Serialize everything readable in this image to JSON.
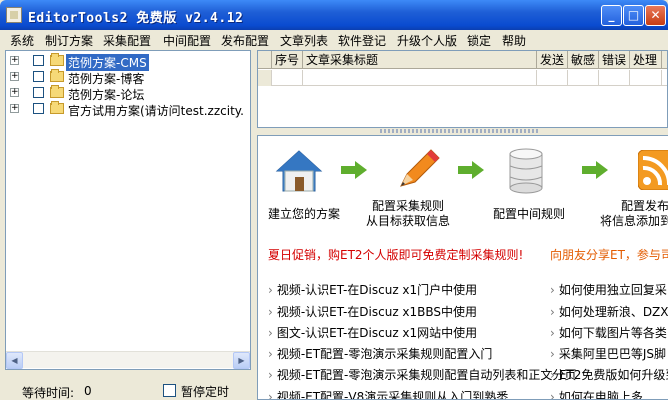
{
  "window": {
    "title": "EditorTools2 免费版 v2.4.12",
    "buttons": {
      "minimize": "_",
      "maximize": "□",
      "close": "✕"
    }
  },
  "menu": [
    "系统",
    "制订方案",
    "采集配置",
    "中间配置",
    "发布配置",
    "文章列表",
    "软件登记",
    "升级个人版",
    "锁定",
    "帮助"
  ],
  "tree": [
    {
      "label": "范例方案-CMS",
      "selected": true
    },
    {
      "label": "范例方案-博客",
      "selected": false
    },
    {
      "label": "范例方案-论坛",
      "selected": false
    },
    {
      "label": "官方试用方案(请访问test.zzcity.",
      "selected": false
    }
  ],
  "status": {
    "wait_label": "等待时间:",
    "wait_value": "0",
    "pause_label": "暂停定时"
  },
  "table": {
    "columns": [
      "序号",
      "文章采集标题",
      "发送",
      "敏感",
      "错误",
      "处理"
    ]
  },
  "guide": {
    "steps": [
      {
        "line1": "",
        "line2": "建立您的方案"
      },
      {
        "line1": "配置采集规则",
        "line2": "从目标获取信息"
      },
      {
        "line1": "",
        "line2": "配置中间规则"
      },
      {
        "line1": "配置发布",
        "line2": "将信息添加到"
      }
    ],
    "promo_left": "夏日促销，购ET2个人版即可免费定制采集规则!",
    "promo_right": "向朋友分享ET，参与司",
    "links_left": [
      "视频-认识ET-在Discuz x1门户中使用",
      "视频-认识ET-在Discuz x1BBS中使用",
      "图文-认识ET-在Discuz x1网站中使用",
      "视频-ET配置-零泡演示采集规则配置入门",
      "视频-ET配置-零泡演示采集规则配置自动列表和正文分页",
      "视频-ET配置-V8演示采集规则从入门到熟悉"
    ],
    "links_right": [
      "如何使用独立回复采",
      "如何处理新浪、DZX等",
      "如何下载图片等各类",
      "采集阿里巴巴等JS脚",
      "ET2免费版如何升级到",
      "如何在电脑上多"
    ]
  },
  "colors": {
    "titlebar": "#0a4bd0",
    "selection": "#316ac5",
    "promo_left": "#d40000",
    "promo_right": "#e35b00",
    "arrow": "#5fae2e"
  }
}
